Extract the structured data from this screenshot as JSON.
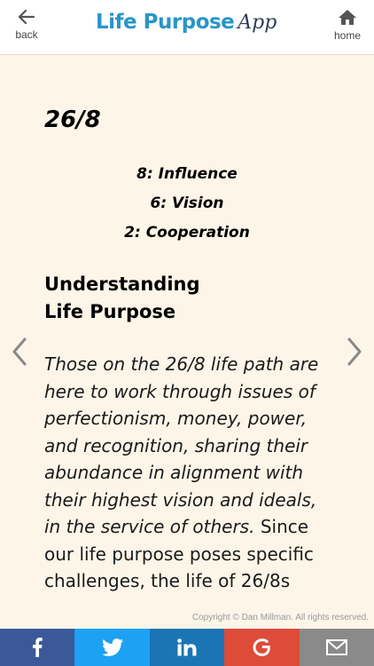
{
  "header": {
    "back_label": "back",
    "home_label": "home",
    "brand_main": "Life Purpose",
    "brand_script": "App"
  },
  "content": {
    "number": "26/8",
    "traits": [
      "8: Influence",
      "6: Vision",
      "2: Cooperation"
    ],
    "heading_line1": "Understanding",
    "heading_line2": "Life Purpose",
    "body_italic": "Those on the 26/8 life path are here to work through issues of perfectionism, money, power, and recognition, sharing their abundance in alignment with their highest vision and ideals, in the service of others.",
    "body_regular": " Since our life purpose poses specific challenges, the life of 26/8s"
  },
  "footer": {
    "copyright": "Copyright © Dan Millman. All rights reserved."
  },
  "share": [
    {
      "name": "facebook",
      "icon": "facebook-icon",
      "color": "#3b5998"
    },
    {
      "name": "twitter",
      "icon": "twitter-icon",
      "color": "#1da1f2"
    },
    {
      "name": "linkedin",
      "icon": "linkedin-icon",
      "color": "#1b75b4"
    },
    {
      "name": "google",
      "icon": "google-icon",
      "color": "#dd4b39"
    },
    {
      "name": "email",
      "icon": "envelope-icon",
      "color": "#8a8a8a"
    }
  ],
  "colors": {
    "brand_blue": "#2a95c9",
    "brand_dark": "#2d3d57",
    "background": "#fdf5e8"
  }
}
